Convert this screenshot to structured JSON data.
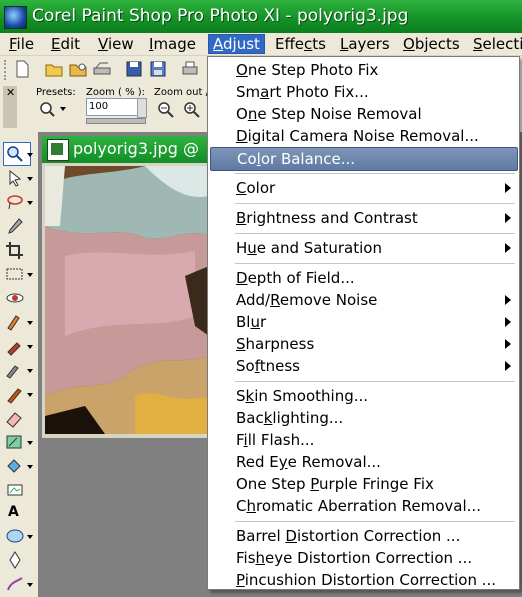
{
  "window": {
    "title": "Corel Paint Shop Pro Photo XI - polyorig3.jpg"
  },
  "menubar": {
    "items": [
      {
        "label": "File",
        "u": "F",
        "rest": "ile"
      },
      {
        "label": "Edit",
        "u": "E",
        "rest": "dit"
      },
      {
        "label": "View",
        "u": "V",
        "rest": "iew"
      },
      {
        "label": "Image",
        "u": "I",
        "rest": "mage"
      },
      {
        "label": "Adjust",
        "u": "A",
        "rest": "djust"
      },
      {
        "label": "Effects",
        "u": "c",
        "pre": "Effe",
        "rest": "ts"
      },
      {
        "label": "Layers",
        "u": "L",
        "rest": "ayers"
      },
      {
        "label": "Objects",
        "u": "O",
        "rest": "bjects"
      },
      {
        "label": "Selections",
        "u": "S",
        "rest": "electio"
      }
    ]
  },
  "toolbar2": {
    "presets_label": "Presets:",
    "zoom_label": "Zoom ( % ):",
    "zoom_value": "100",
    "zoom_out_label": "Zoom out / i"
  },
  "document": {
    "title": "polyorig3.jpg @"
  },
  "adjust_menu": {
    "items": [
      {
        "pre": "",
        "u": "O",
        "rest": "ne Step Photo Fix",
        "submenu": false
      },
      {
        "pre": "Sm",
        "u": "a",
        "rest": "rt Photo Fix...",
        "submenu": false
      },
      {
        "pre": "O",
        "u": "n",
        "rest": "e Step Noise Removal",
        "submenu": false
      },
      {
        "pre": "",
        "u": "D",
        "rest": "igital Camera Noise Removal...",
        "submenu": false
      },
      {
        "pre": "Co",
        "u": "l",
        "rest": "or Balance...",
        "submenu": false,
        "highlighted": true
      },
      {
        "pre": "",
        "u": "C",
        "rest": "olor",
        "submenu": true
      },
      {
        "pre": "",
        "u": "B",
        "rest": "rightness and Contrast",
        "submenu": true
      },
      {
        "pre": "H",
        "u": "u",
        "rest": "e and Saturation",
        "submenu": true
      },
      {
        "pre": "",
        "u": "D",
        "rest": "epth of Field...",
        "submenu": false
      },
      {
        "pre": "Add/",
        "u": "R",
        "rest": "emove Noise",
        "submenu": true
      },
      {
        "pre": "Bl",
        "u": "u",
        "rest": "r",
        "submenu": true
      },
      {
        "pre": "",
        "u": "S",
        "rest": "harpness",
        "submenu": true
      },
      {
        "pre": "So",
        "u": "f",
        "rest": "tness",
        "submenu": true
      },
      {
        "pre": "S",
        "u": "k",
        "rest": "in Smoothing...",
        "submenu": false
      },
      {
        "pre": "Bac",
        "u": "k",
        "rest": "lighting...",
        "submenu": false
      },
      {
        "pre": "F",
        "u": "i",
        "rest": "ll Flash...",
        "submenu": false
      },
      {
        "pre": "Red E",
        "u": "y",
        "rest": "e Removal...",
        "submenu": false
      },
      {
        "pre": "One Step ",
        "u": "P",
        "rest": "urple Fringe Fix",
        "submenu": false
      },
      {
        "pre": "C",
        "u": "h",
        "rest": "romatic Aberration Removal...",
        "submenu": false
      },
      {
        "pre": "Barrel ",
        "u": "D",
        "rest": "istortion Correction ...",
        "submenu": false
      },
      {
        "pre": "Fis",
        "u": "h",
        "rest": "eye Distortion Correction ...",
        "submenu": false
      },
      {
        "pre": "",
        "u": "P",
        "rest": "incushion Distortion Correction ...",
        "submenu": false
      }
    ]
  },
  "colors": {
    "title_green": "#129126",
    "menu_highlight": "#5f7aa3",
    "menubar_active": "#316ac5"
  }
}
